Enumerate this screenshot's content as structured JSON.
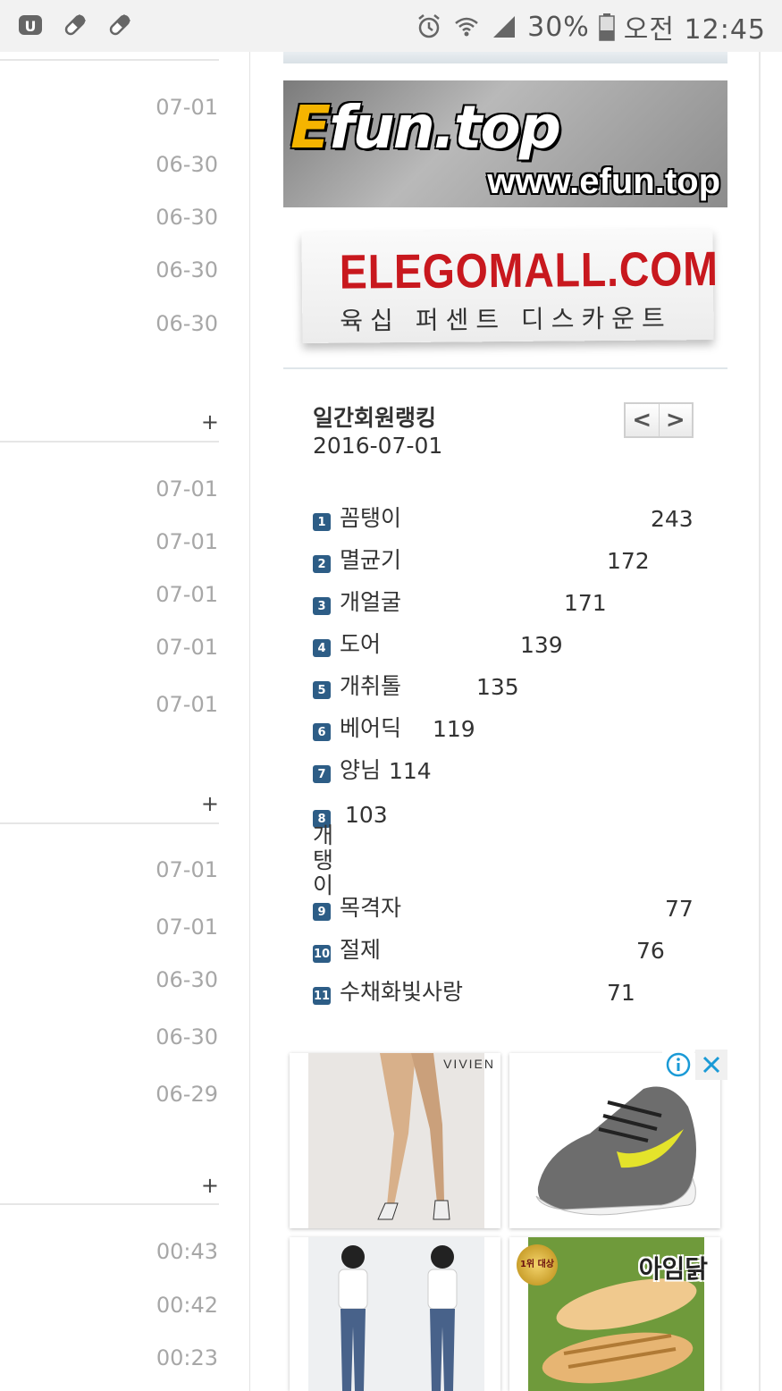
{
  "status_bar": {
    "battery": "30%",
    "time": "오전 12:45"
  },
  "left_column": {
    "group1_dates": [
      "07-01",
      "06-30",
      "06-30",
      "06-30",
      "06-30"
    ],
    "group2_dates": [
      "07-01",
      "07-01",
      "07-01",
      "07-01",
      "07-01"
    ],
    "group3_dates": [
      "07-01",
      "07-01",
      "06-30",
      "06-30",
      "06-29"
    ],
    "group4_times": [
      "00:43",
      "00:42",
      "00:23"
    ],
    "more_label": "+"
  },
  "banners": {
    "efun_logo_e": "E",
    "efun_logo_rest": "fun.top",
    "efun_url": "www.efun.top",
    "elego_title": "ELEGOMALL.COM",
    "elego_subtitle": "육십 퍼센트 디스카운트"
  },
  "ranking": {
    "title": "일간회원랭킹",
    "date": "2016-07-01",
    "prev_label": "<",
    "next_label": ">",
    "items": [
      {
        "rank": "1",
        "name": "꼼탱이",
        "score": "243"
      },
      {
        "rank": "2",
        "name": "멸균기",
        "score": "172"
      },
      {
        "rank": "3",
        "name": "개얼굴",
        "score": "171"
      },
      {
        "rank": "4",
        "name": "도어",
        "score": "139"
      },
      {
        "rank": "5",
        "name": "개취톨",
        "score": "135"
      },
      {
        "rank": "6",
        "name": "베어딕",
        "score": "119"
      },
      {
        "rank": "7",
        "name": "양님",
        "score": "114"
      },
      {
        "rank": "8",
        "name": "개탱이",
        "score": "103"
      },
      {
        "rank": "9",
        "name": "목격자",
        "score": "77"
      },
      {
        "rank": "10",
        "name": "절제",
        "score": "76"
      },
      {
        "rank": "11",
        "name": "수채화빛사랑",
        "score": "71"
      }
    ]
  },
  "ads": {
    "vivien_brand": "VIVIEN",
    "aim_brand": "아임닭",
    "seal_text": "1위 대상"
  },
  "colors": {
    "rank_badge": "#2d5d86",
    "date_gray": "#a7a7a7",
    "elego_red": "#c8181e",
    "efun_yellow": "#f5b400"
  }
}
